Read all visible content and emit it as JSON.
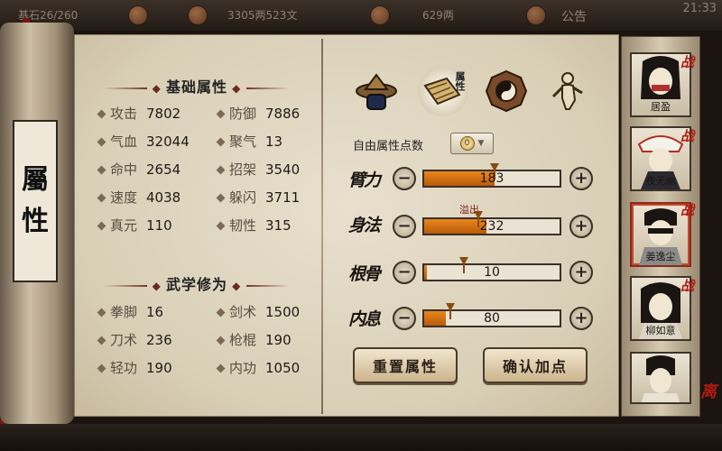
{
  "topbar": {
    "res1": "基石26/260",
    "res2": "3305两523文",
    "res3": "629两",
    "notice": "公告",
    "time": "21:33"
  },
  "scroll": {
    "chars": [
      "屬",
      "性"
    ]
  },
  "basic": {
    "title": "基础属性",
    "stats": [
      {
        "label": "攻击",
        "value": "7802"
      },
      {
        "label": "防御",
        "value": "7886"
      },
      {
        "label": "气血",
        "value": "32044"
      },
      {
        "label": "聚气",
        "value": "13"
      },
      {
        "label": "命中",
        "value": "2654"
      },
      {
        "label": "招架",
        "value": "3540"
      },
      {
        "label": "速度",
        "value": "4038"
      },
      {
        "label": "躲闪",
        "value": "3711"
      },
      {
        "label": "真元",
        "value": "110"
      },
      {
        "label": "韧性",
        "value": "315"
      }
    ]
  },
  "martial": {
    "title": "武学修为",
    "stats": [
      {
        "label": "拳脚",
        "value": "16"
      },
      {
        "label": "剑术",
        "value": "1500"
      },
      {
        "label": "刀术",
        "value": "236"
      },
      {
        "label": "枪棍",
        "value": "190"
      },
      {
        "label": "轻功",
        "value": "190"
      },
      {
        "label": "内功",
        "value": "1050"
      }
    ]
  },
  "tabs": {
    "attr_tag": "属性"
  },
  "free_points": {
    "label": "自由属性点数",
    "value": "0"
  },
  "attributes": [
    {
      "name": "臂力",
      "value": "183",
      "fill": 0.52,
      "marker": 0.52
    },
    {
      "name": "身法",
      "value": "232",
      "fill": 0.46,
      "marker": 0.4
    },
    {
      "name": "根骨",
      "value": "10",
      "fill": 0.02,
      "marker": 0.29
    },
    {
      "name": "内息",
      "value": "80",
      "fill": 0.16,
      "marker": 0.19
    }
  ],
  "overflow_text": "溢出",
  "buttons": {
    "reset": "重置属性",
    "confirm": "确认加点"
  },
  "roster": [
    {
      "name": "居盈",
      "battle": "战"
    },
    {
      "name": "夜无幽",
      "battle": "战"
    },
    {
      "name": "姜逸尘",
      "battle": "战"
    },
    {
      "name": "柳如意",
      "battle": "战"
    },
    {
      "name": "",
      "battle": ""
    }
  ],
  "colors": {
    "accent": "#e8871c",
    "ink": "#1e1a16",
    "seal_red": "#b01a10"
  }
}
